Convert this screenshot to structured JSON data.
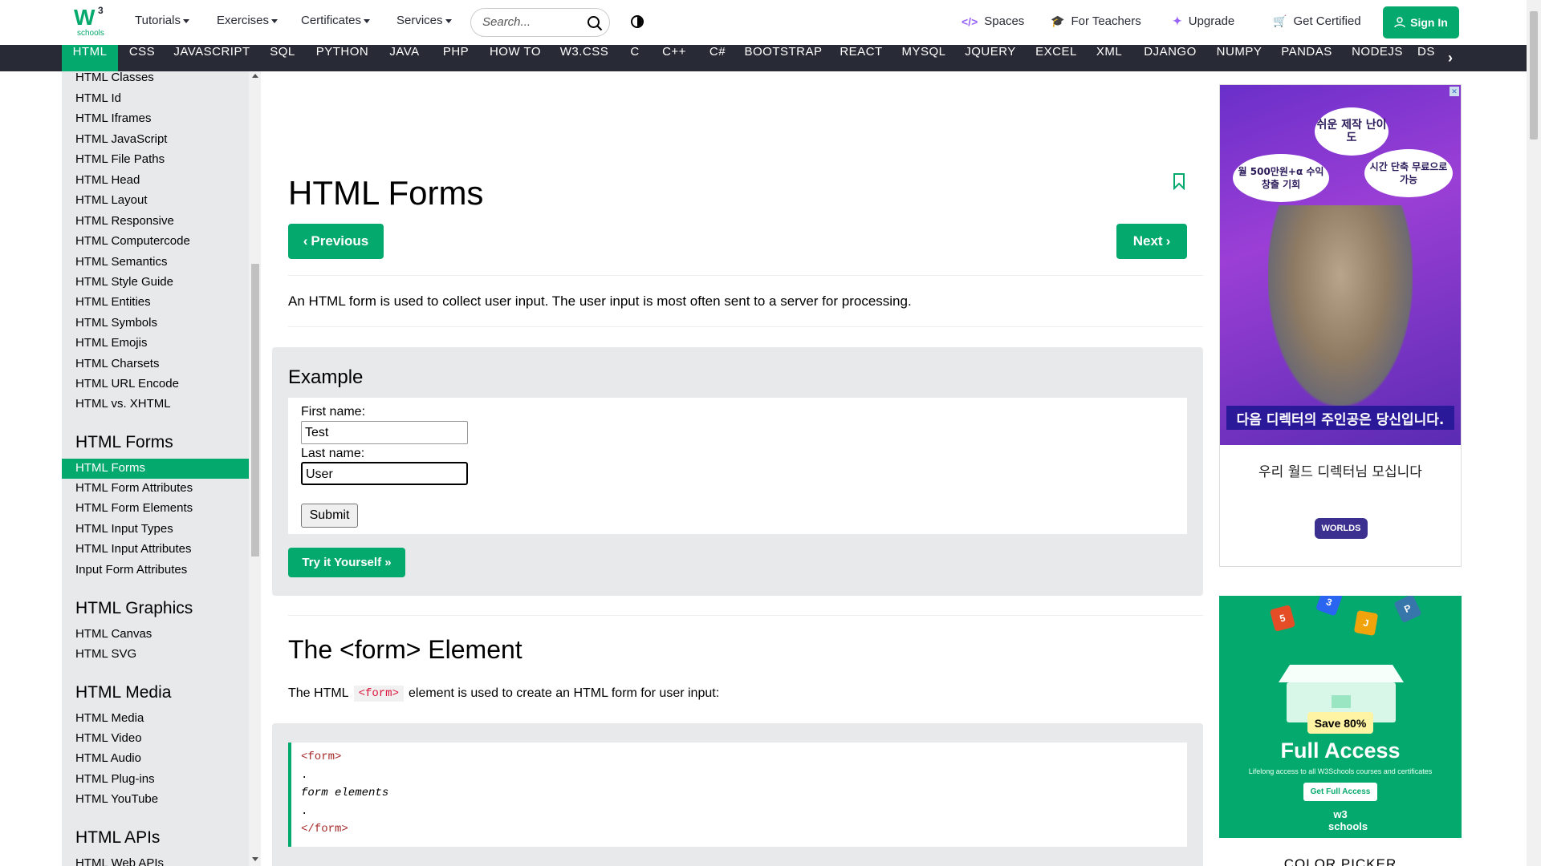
{
  "logo": {
    "main": "W",
    "sup": "3",
    "sub": "schools"
  },
  "topnav": {
    "menus": [
      "Tutorials",
      "Exercises",
      "Certificates",
      "Services"
    ],
    "search_placeholder": "Search...",
    "right_links": [
      {
        "icon": "code-icon",
        "glyph": "</>",
        "label": "Spaces"
      },
      {
        "icon": "graduation-cap-icon",
        "glyph": "🎓",
        "label": "For Teachers"
      },
      {
        "icon": "sparkle-icon",
        "glyph": "✦",
        "label": "Upgrade"
      },
      {
        "icon": "cart-icon",
        "glyph": "🛒",
        "label": "Get Certified"
      }
    ],
    "signin_label": "Sign In"
  },
  "langbar": {
    "items": [
      "HTML",
      "CSS",
      "JAVASCRIPT",
      "SQL",
      "PYTHON",
      "JAVA",
      "PHP",
      "HOW TO",
      "W3.CSS",
      "C",
      "C++",
      "C#",
      "BOOTSTRAP",
      "REACT",
      "MYSQL",
      "JQUERY",
      "EXCEL",
      "XML",
      "DJANGO",
      "NUMPY",
      "PANDAS",
      "NODEJS",
      "DS"
    ],
    "active": "HTML"
  },
  "sidebar": {
    "top_items": [
      "HTML Classes",
      "HTML Id",
      "HTML Iframes",
      "HTML JavaScript",
      "HTML File Paths",
      "HTML Head",
      "HTML Layout",
      "HTML Responsive",
      "HTML Computercode",
      "HTML Semantics",
      "HTML Style Guide",
      "HTML Entities",
      "HTML Symbols",
      "HTML Emojis",
      "HTML Charsets",
      "HTML URL Encode",
      "HTML vs. XHTML"
    ],
    "sections": [
      {
        "heading": "HTML Forms",
        "items": [
          "HTML Forms",
          "HTML Form Attributes",
          "HTML Form Elements",
          "HTML Input Types",
          "HTML Input Attributes",
          "Input Form Attributes"
        ]
      },
      {
        "heading": "HTML Graphics",
        "items": [
          "HTML Canvas",
          "HTML SVG"
        ]
      },
      {
        "heading": "HTML Media",
        "items": [
          "HTML Media",
          "HTML Video",
          "HTML Audio",
          "HTML Plug-ins",
          "HTML YouTube"
        ]
      },
      {
        "heading": "HTML APIs",
        "items": [
          "HTML Web APIs"
        ]
      }
    ],
    "active": "HTML Forms"
  },
  "main": {
    "title": "HTML Forms",
    "prev_label": "Previous",
    "next_label": "Next",
    "intro": "An HTML form is used to collect user input. The user input is most often sent to a server for processing.",
    "example": {
      "title": "Example",
      "first_label": "First name:",
      "first_value": "Test",
      "last_label": "Last name:",
      "last_value": "User",
      "submit_label": "Submit",
      "try_label": "Try it Yourself »"
    },
    "section_title": "The <form> Element",
    "section_text_before": "The HTML",
    "section_code": "<form>",
    "section_text_after": "element is used to create an HTML form for user input:",
    "code_lines": [
      "<form>",
      ".",
      "form elements",
      ".",
      "</form>"
    ]
  },
  "ads": {
    "ad1": {
      "bubble1": "쉬운 제작 난이도",
      "bubble2": "월 500만원+α 수익 창출 기회",
      "bubble3": "시간 단축 무료으로 가능",
      "banner": "다음 디렉터의 주인공은 당신입니다.",
      "caption": "우리 월드 디렉터님 모십니다",
      "logo": "WORLDS"
    },
    "ad2": {
      "save": "Save 80%",
      "title": "Full Access",
      "sub": "Lifelong access to all W3Schools courses and certificates",
      "button": "Get Full Access",
      "logo": "w3 schools"
    },
    "color_picker": "COLOR PICKER"
  },
  "colors": {
    "brand_green": "#04AA6D",
    "dark": "#282A35",
    "sidebar_bg": "#E7E9EB"
  }
}
